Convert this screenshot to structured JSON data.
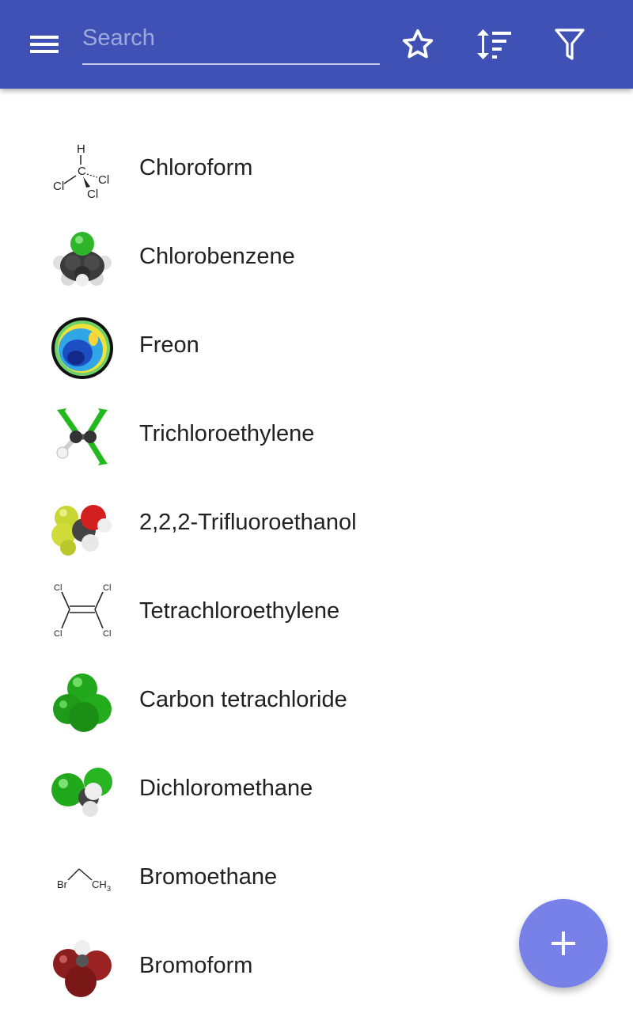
{
  "header": {
    "search": {
      "placeholder": "Search",
      "value": ""
    },
    "icons": [
      "menu-icon",
      "star-icon",
      "sort-icon",
      "filter-icon"
    ],
    "background": "#3f51b5"
  },
  "list": {
    "items": [
      {
        "name": "Chloroform",
        "icon": "chloroform-structure-icon"
      },
      {
        "name": "Chlorobenzene",
        "icon": "chlorobenzene-molecule-icon"
      },
      {
        "name": "Freon",
        "icon": "ozone-hole-icon"
      },
      {
        "name": "Trichloroethylene",
        "icon": "trichloroethylene-molecule-icon"
      },
      {
        "name": "2,2,2-Trifluoroethanol",
        "icon": "trifluoroethanol-molecule-icon"
      },
      {
        "name": "Tetrachloroethylene",
        "icon": "tetrachloroethylene-structure-icon"
      },
      {
        "name": "Carbon tetrachloride",
        "icon": "carbon-tetrachloride-molecule-icon"
      },
      {
        "name": "Dichloromethane",
        "icon": "dichloromethane-molecule-icon"
      },
      {
        "name": "Bromoethane",
        "icon": "bromoethane-structure-icon"
      },
      {
        "name": "Bromoform",
        "icon": "bromoform-molecule-icon"
      }
    ]
  },
  "fab": {
    "icon": "plus-icon",
    "color": "#7781e7"
  }
}
